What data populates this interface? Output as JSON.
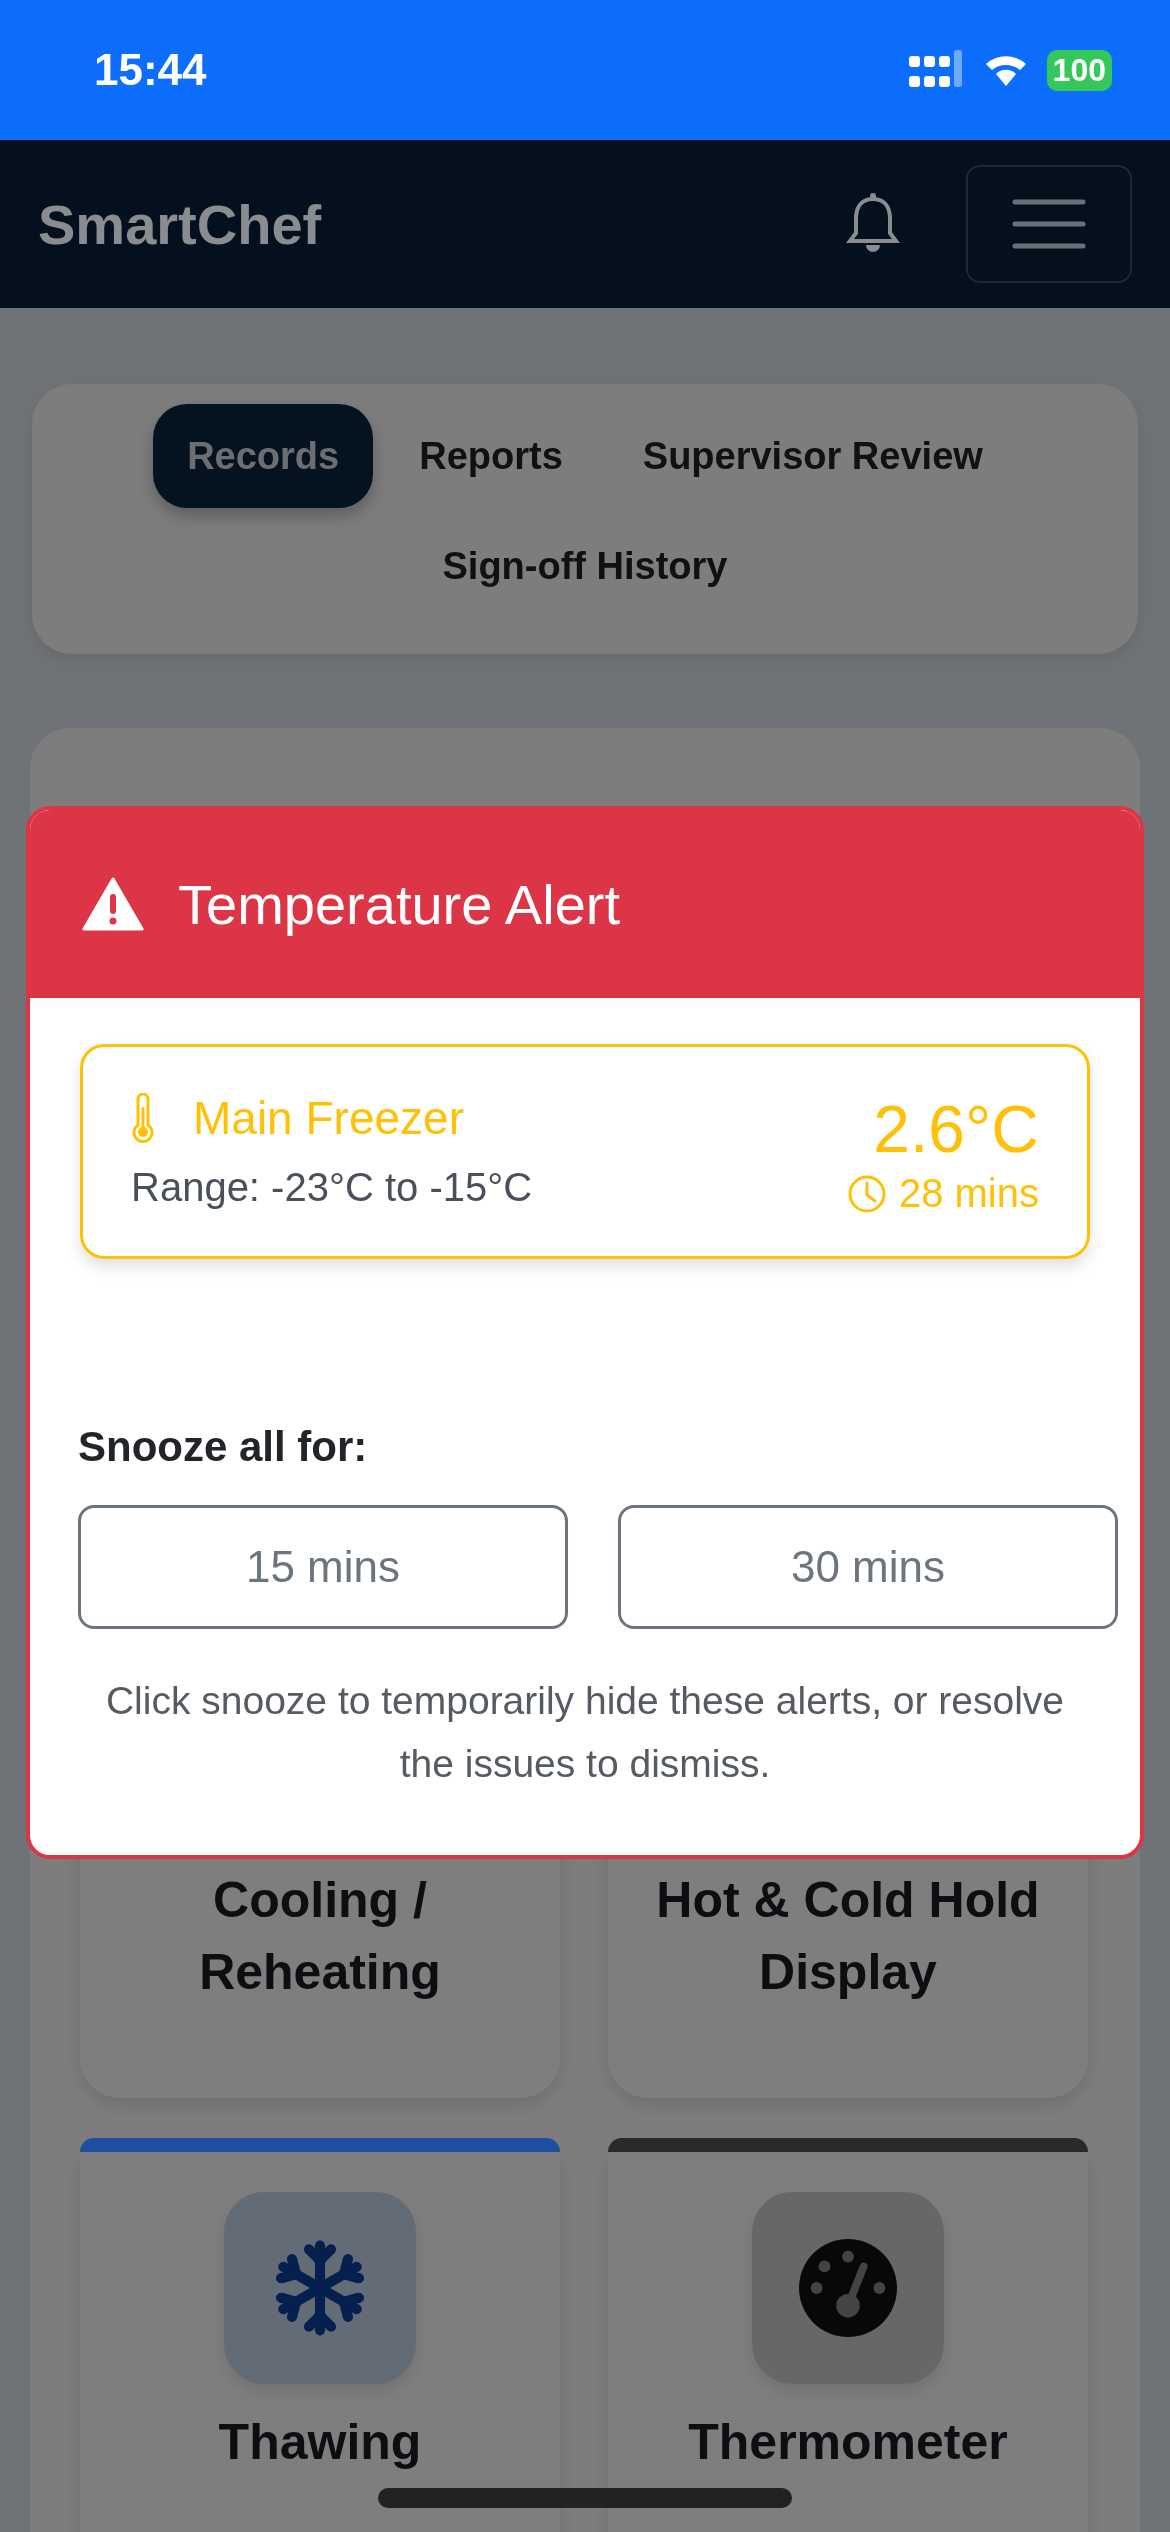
{
  "status_bar": {
    "time": "15:44",
    "battery": "100"
  },
  "navbar": {
    "brand": "SmartChef"
  },
  "tabs": [
    {
      "label": "Records",
      "selected": true
    },
    {
      "label": "Reports",
      "selected": false
    },
    {
      "label": "Supervisor Review",
      "selected": false
    },
    {
      "label": "Sign-off History",
      "selected": false
    }
  ],
  "modules": [
    {
      "title": "Cooling / Reheating",
      "kind": "plain"
    },
    {
      "title": "Hot & Cold Hold Display",
      "kind": "plain"
    },
    {
      "title": "Thawing",
      "kind": "tile",
      "color": "#1f4fa3"
    },
    {
      "title": "Thermometer",
      "kind": "tile",
      "color": "#2a2a2a"
    }
  ],
  "alert_modal": {
    "title": "Temperature Alert",
    "alerts": [
      {
        "name": "Main Freezer",
        "range": "Range: -23°C to -15°C",
        "reading": "2.6°C",
        "duration": "28 mins"
      }
    ],
    "snooze_label": "Snooze all for:",
    "snooze_options": [
      "15 mins",
      "30 mins"
    ],
    "hint": "Click snooze to temporarily hide these alerts, or resolve the issues to dismiss."
  }
}
